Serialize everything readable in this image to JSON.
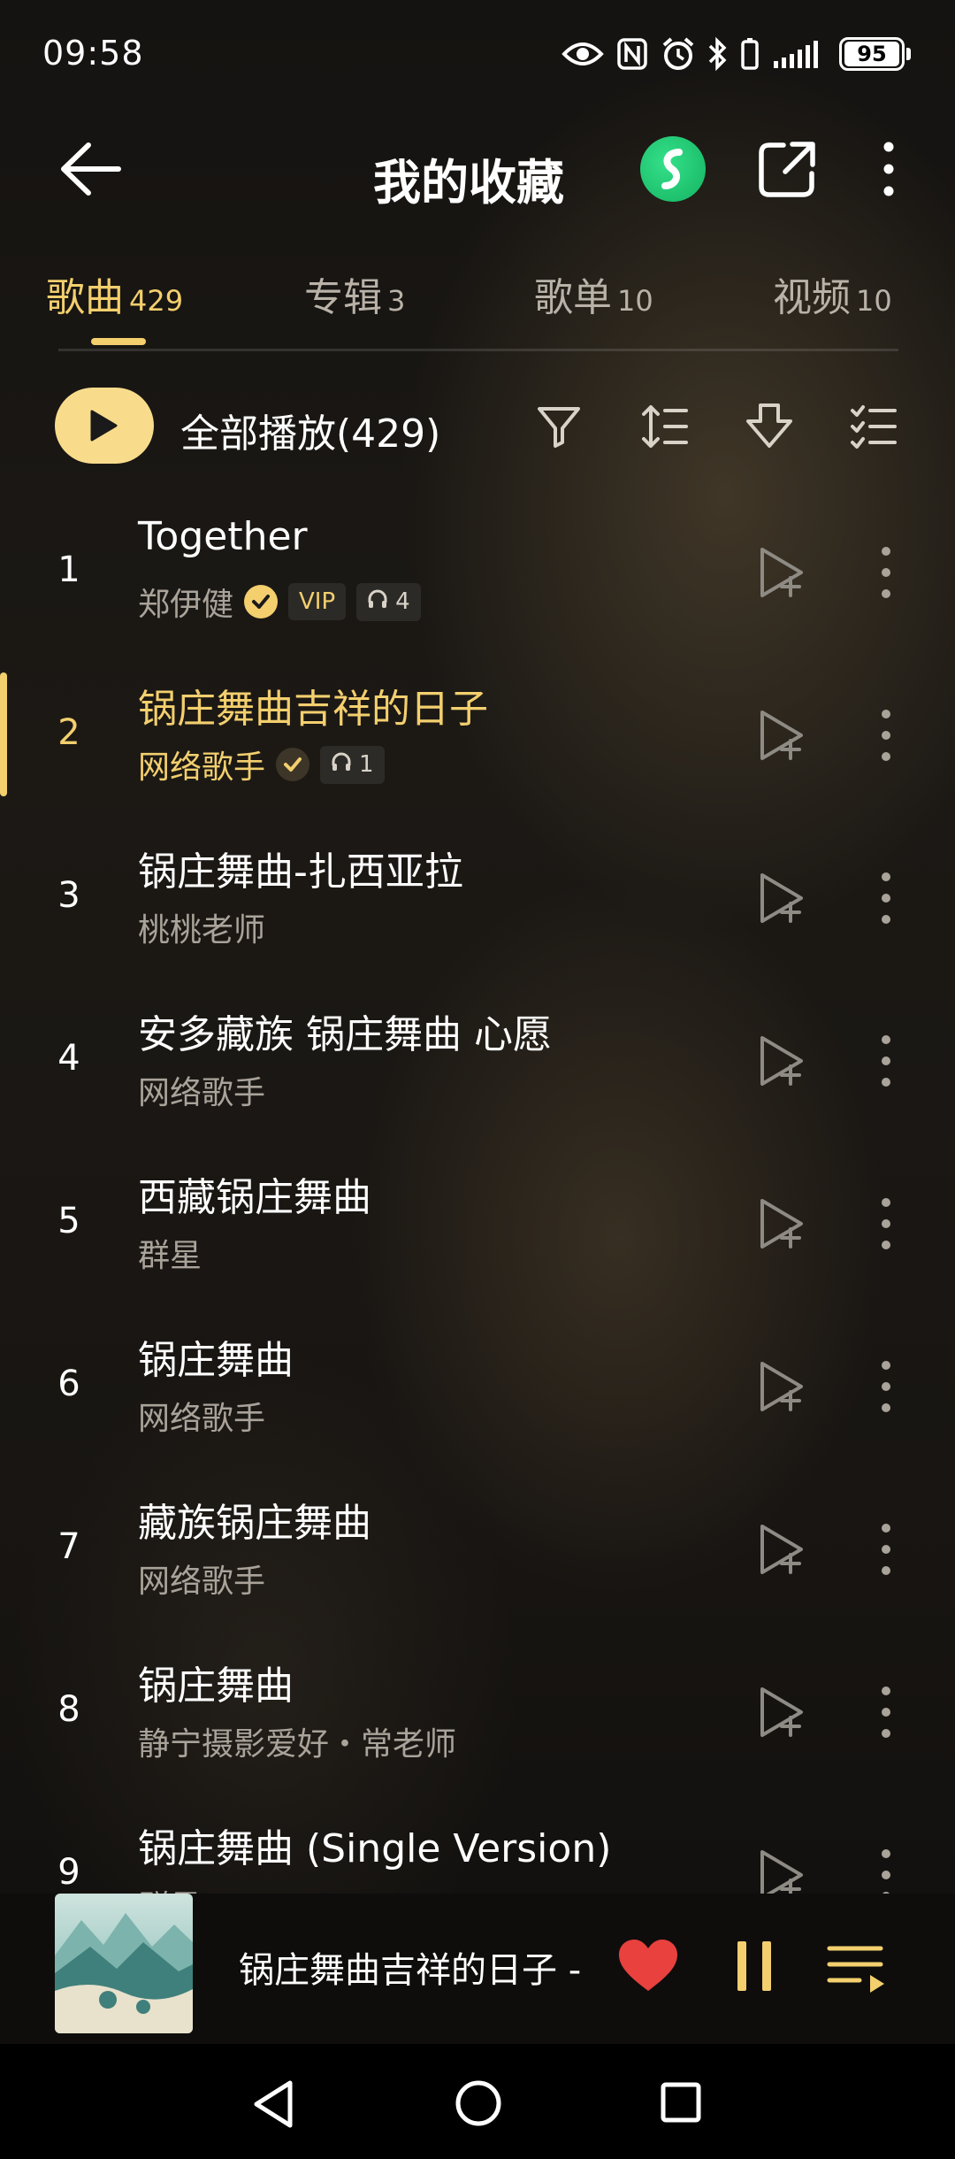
{
  "status_bar": {
    "time": "09:58",
    "battery": "95"
  },
  "header": {
    "title": "我的收藏",
    "icons": [
      "back-arrow-icon",
      "brand-logo-icon",
      "share-icon",
      "more-icon"
    ]
  },
  "tabs": [
    {
      "label": "歌曲",
      "count": "429",
      "active": true
    },
    {
      "label": "专辑",
      "count": "3",
      "active": false
    },
    {
      "label": "歌单",
      "count": "10",
      "active": false
    },
    {
      "label": "视频",
      "count": "10",
      "active": false
    }
  ],
  "toolbar": {
    "play_all_label": "全部播放(429)",
    "icons": [
      "filter-icon",
      "sort-icon",
      "download-icon",
      "multi-select-icon"
    ]
  },
  "songs": [
    {
      "index": "1",
      "title": "Together",
      "artist": "郑伊健",
      "verified": true,
      "vip": "VIP",
      "listen_count": "4"
    },
    {
      "index": "2",
      "title": "锅庄舞曲吉祥的日子",
      "artist": "网络歌手",
      "verified": true,
      "listen_count": "1",
      "playing": true
    },
    {
      "index": "3",
      "title": "锅庄舞曲-扎西亚拉",
      "artist": "桃桃老师"
    },
    {
      "index": "4",
      "title": "安多藏族 锅庄舞曲 心愿",
      "artist": "网络歌手"
    },
    {
      "index": "5",
      "title": "西藏锅庄舞曲",
      "artist": "群星"
    },
    {
      "index": "6",
      "title": "锅庄舞曲",
      "artist": "网络歌手"
    },
    {
      "index": "7",
      "title": "藏族锅庄舞曲",
      "artist": "网络歌手"
    },
    {
      "index": "8",
      "title": "锅庄舞曲",
      "artist": "静宁摄影爱好・常老师"
    },
    {
      "index": "9",
      "title": "锅庄舞曲 (Single Version)",
      "artist": "群星"
    }
  ],
  "mini_player": {
    "title": "锅庄舞曲吉祥的日子 -",
    "liked": true,
    "state": "playing"
  },
  "colors": {
    "accent": "#f3cf6e",
    "play_button": "#f8dc8c",
    "heart": "#e8413e"
  }
}
